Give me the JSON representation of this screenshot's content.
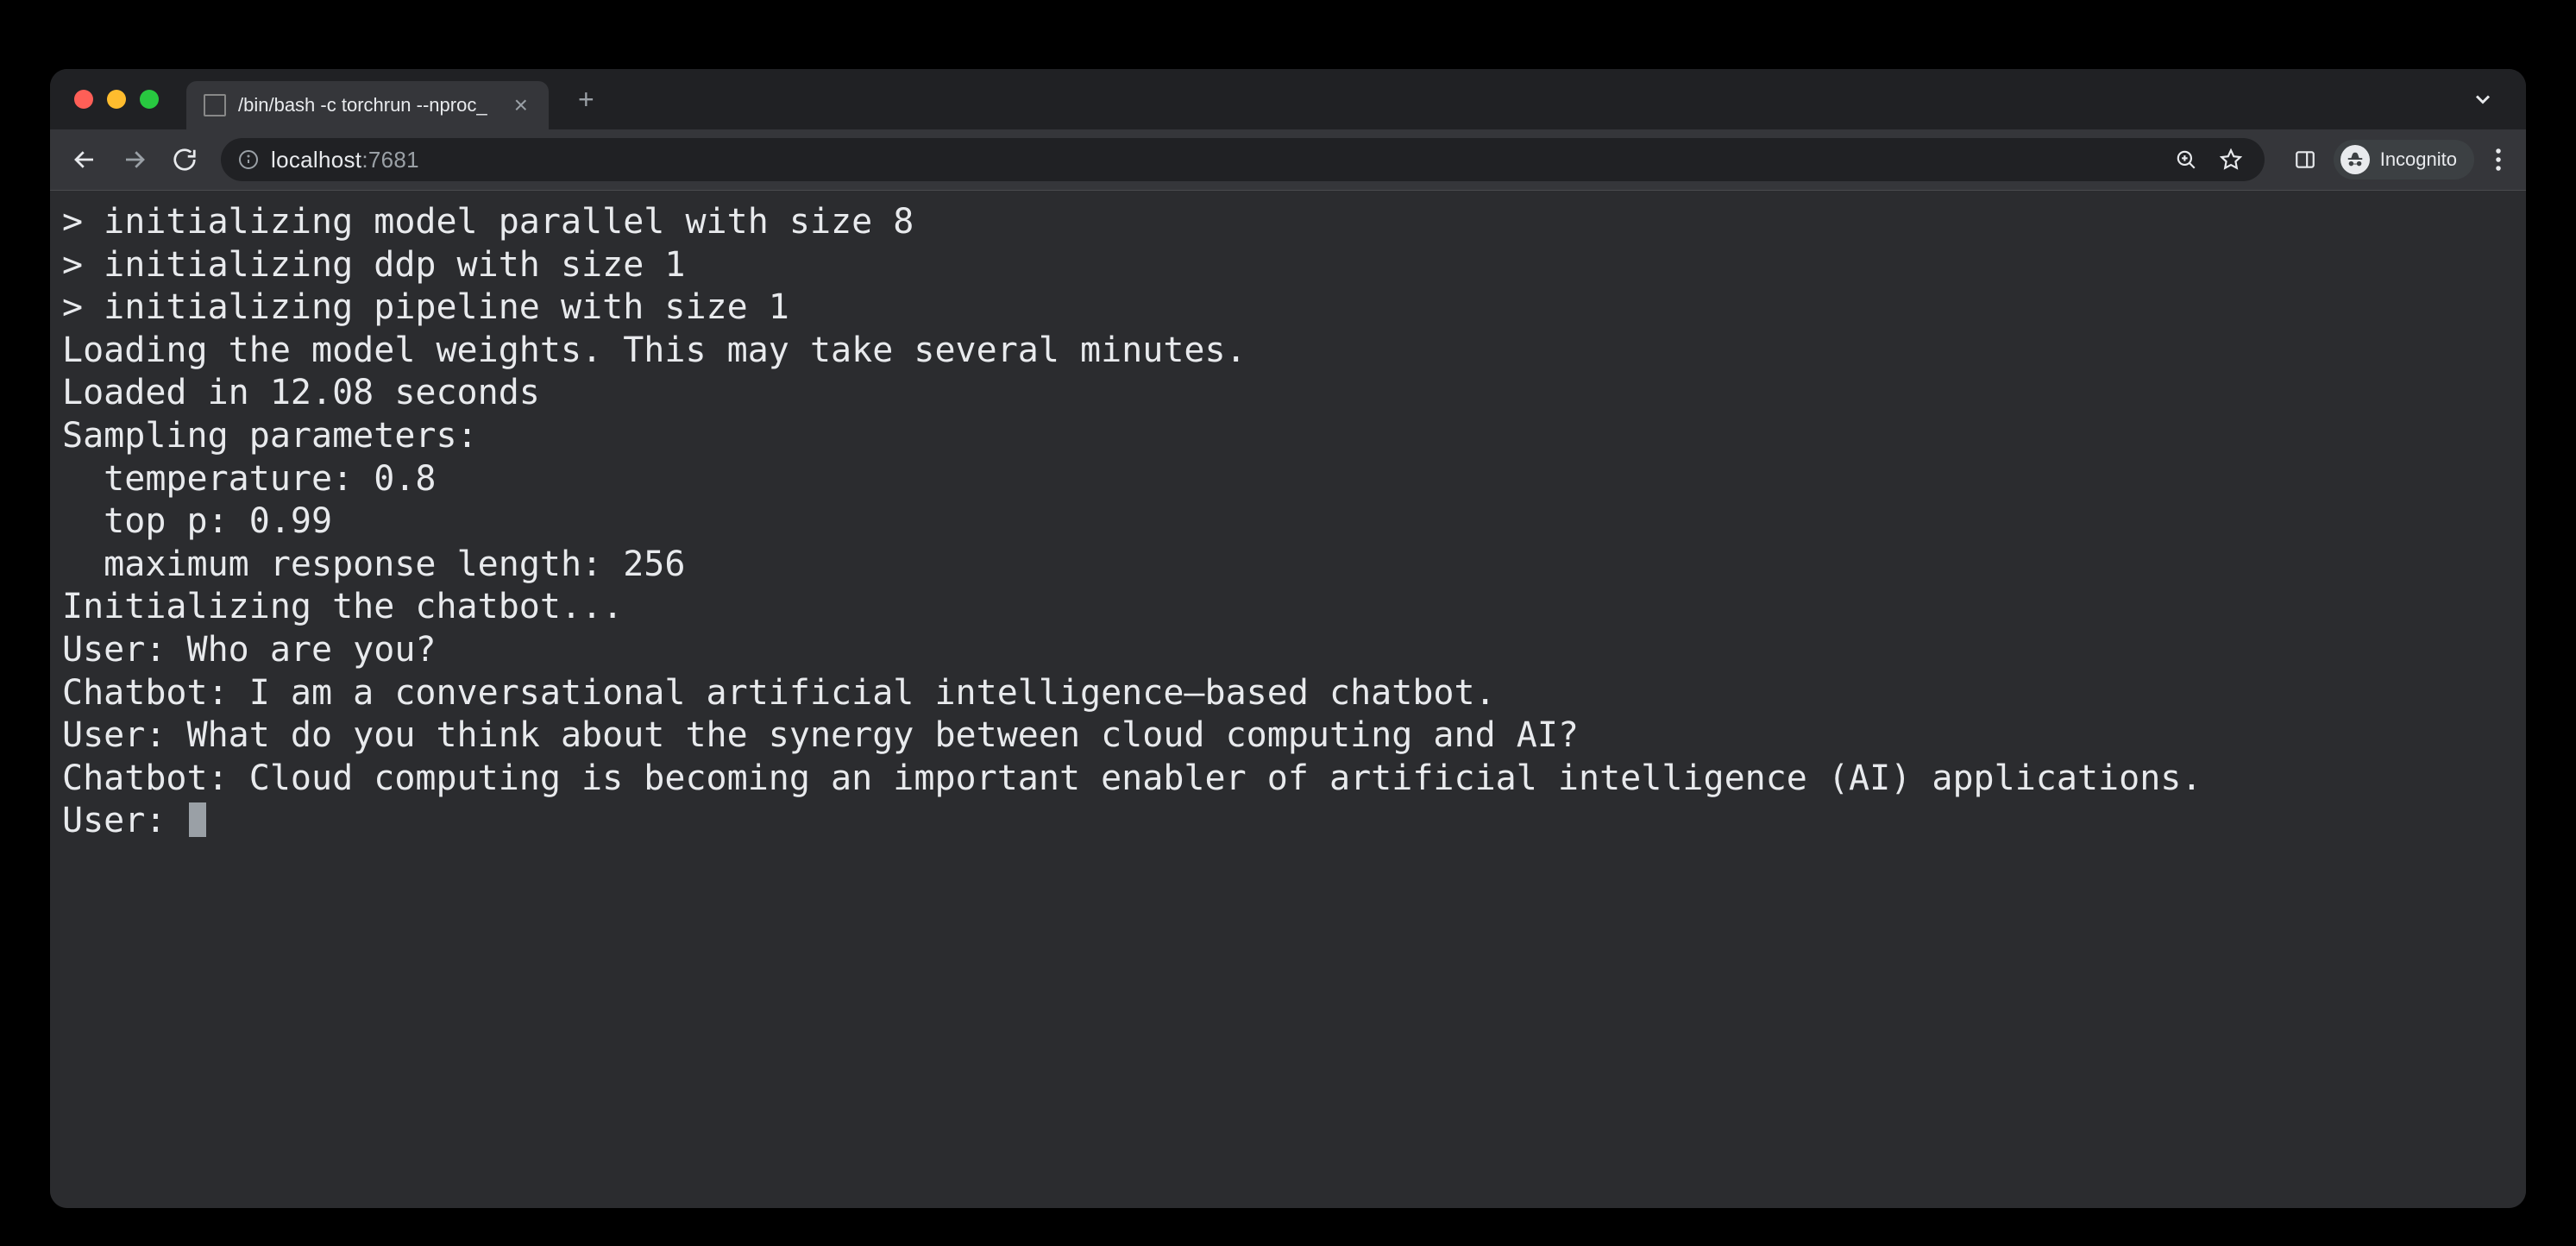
{
  "tab": {
    "title": "/bin/bash -c torchrun --nproc_"
  },
  "url": {
    "host": "localhost",
    "port": ":7681"
  },
  "incognito": {
    "label": "Incognito"
  },
  "terminal": {
    "lines": [
      "> initializing model parallel with size 8",
      "> initializing ddp with size 1",
      "> initializing pipeline with size 1",
      "Loading the model weights. This may take several minutes.",
      "Loaded in 12.08 seconds",
      "Sampling parameters:",
      "  temperature: 0.8",
      "  top p: 0.99",
      "  maximum response length: 256",
      "Initializing the chatbot...",
      "User: Who are you?",
      "Chatbot: I am a conversational artificial intelligence–based chatbot.",
      "User: What do you think about the synergy between cloud computing and AI?",
      "Chatbot: Cloud computing is becoming an important enabler of artificial intelligence (AI) applications.",
      "User: "
    ]
  }
}
